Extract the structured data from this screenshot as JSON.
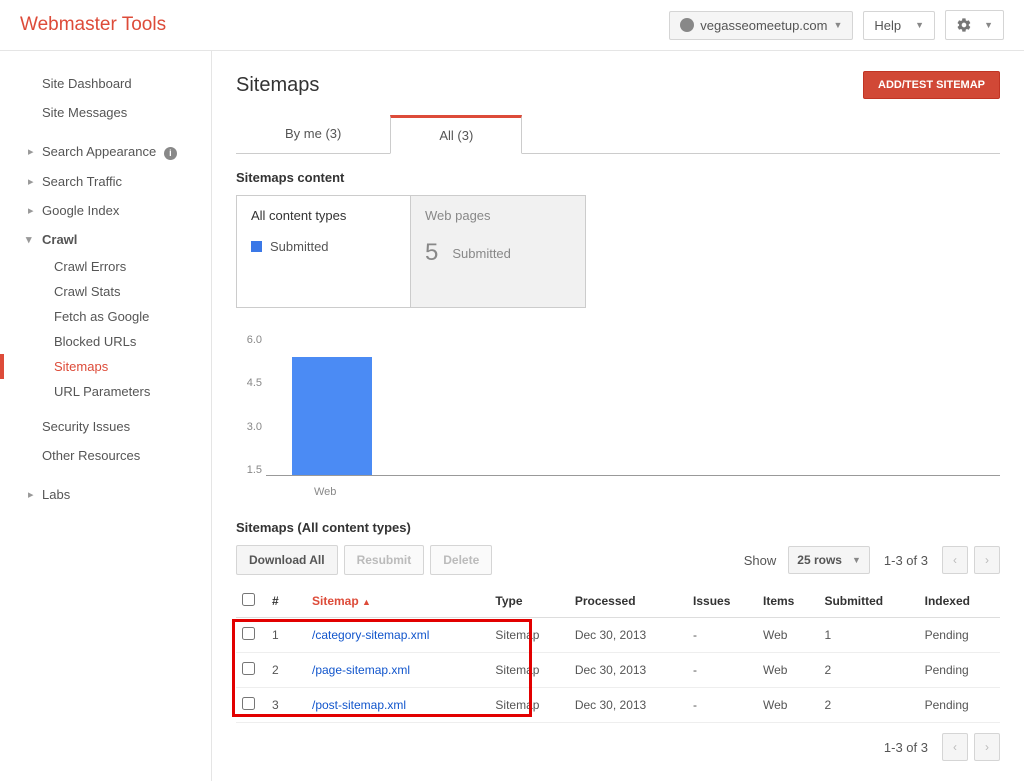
{
  "header": {
    "logo": "Webmaster Tools",
    "site": "vegasseomeetup.com",
    "help": "Help"
  },
  "sidebar": {
    "dashboard": "Site Dashboard",
    "messages": "Site Messages",
    "search_appearance": "Search Appearance",
    "search_traffic": "Search Traffic",
    "google_index": "Google Index",
    "crawl": "Crawl",
    "crawl_errors": "Crawl Errors",
    "crawl_stats": "Crawl Stats",
    "fetch_as_google": "Fetch as Google",
    "blocked_urls": "Blocked URLs",
    "sitemaps": "Sitemaps",
    "url_parameters": "URL Parameters",
    "security_issues": "Security Issues",
    "other_resources": "Other Resources",
    "labs": "Labs"
  },
  "main": {
    "title": "Sitemaps",
    "add_button": "ADD/TEST SITEMAP",
    "tabs": {
      "by_me": "By me (3)",
      "all": "All (3)"
    },
    "section_content": "Sitemaps content",
    "cards": {
      "all_types": "All content types",
      "submitted": "Submitted",
      "web_pages": "Web pages",
      "web_count": "5",
      "web_submitted": "Submitted"
    },
    "chart_data": {
      "type": "bar",
      "categories": [
        "Web"
      ],
      "values": [
        5
      ],
      "y_ticks": [
        "6.0",
        "4.5",
        "3.0",
        "1.5"
      ],
      "ylim": [
        0,
        6
      ]
    },
    "table": {
      "title": "Sitemaps (All content types)",
      "download_all": "Download All",
      "resubmit": "Resubmit",
      "delete": "Delete",
      "show": "Show",
      "rows_select": "25 rows",
      "pager": "1-3 of 3",
      "headers": {
        "num": "#",
        "sitemap": "Sitemap",
        "type": "Type",
        "processed": "Processed",
        "issues": "Issues",
        "items": "Items",
        "submitted": "Submitted",
        "indexed": "Indexed"
      },
      "rows": [
        {
          "num": "1",
          "sitemap": "/category-sitemap.xml",
          "type": "Sitemap",
          "processed": "Dec 30, 2013",
          "issues": "-",
          "items": "Web",
          "submitted": "1",
          "indexed": "Pending"
        },
        {
          "num": "2",
          "sitemap": "/page-sitemap.xml",
          "type": "Sitemap",
          "processed": "Dec 30, 2013",
          "issues": "-",
          "items": "Web",
          "submitted": "2",
          "indexed": "Pending"
        },
        {
          "num": "3",
          "sitemap": "/post-sitemap.xml",
          "type": "Sitemap",
          "processed": "Dec 30, 2013",
          "issues": "-",
          "items": "Web",
          "submitted": "2",
          "indexed": "Pending"
        }
      ]
    }
  }
}
